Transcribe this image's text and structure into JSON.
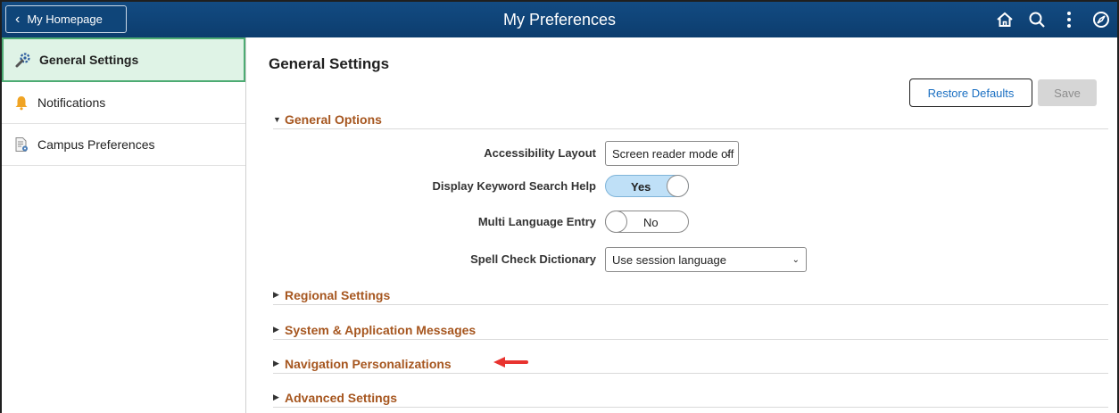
{
  "header": {
    "back_label": "My Homepage",
    "title": "My Preferences",
    "icons": [
      "home-icon",
      "search-icon",
      "actions-menu-icon",
      "navbar-compass-icon"
    ],
    "accent_color": "#134b82"
  },
  "sidebar": {
    "items": [
      {
        "label": "General Settings",
        "icon": "wrench-gear-icon",
        "active": true
      },
      {
        "label": "Notifications",
        "icon": "bell-icon",
        "active": false
      },
      {
        "label": "Campus Preferences",
        "icon": "document-gear-icon",
        "active": false
      }
    ]
  },
  "main": {
    "title": "General Settings",
    "restore_label": "Restore Defaults",
    "save_label": "Save",
    "general_options": {
      "heading": "General Options",
      "expanded": true,
      "rows": [
        {
          "label": "Accessibility Layout",
          "type": "select",
          "value": "Screen reader mode off"
        },
        {
          "label": "Display Keyword Search Help",
          "type": "toggle",
          "value": "Yes"
        },
        {
          "label": "Multi Language Entry",
          "type": "toggle",
          "value": "No"
        },
        {
          "label": "Spell Check Dictionary",
          "type": "select",
          "value": "Use session language"
        }
      ]
    },
    "collapsed_sections": [
      "Regional Settings",
      "System & Application Messages",
      "Navigation Personalizations",
      "Advanced Settings"
    ],
    "section_color": "#a6561f"
  }
}
